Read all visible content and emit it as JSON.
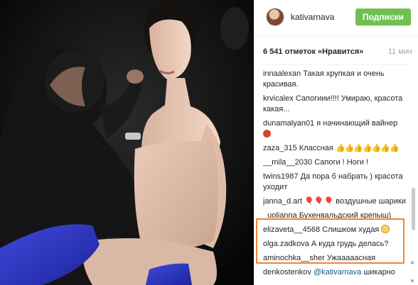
{
  "post": {
    "username": "kativarnava",
    "follow_label": "Подписки",
    "likes_text": "6 541 отметок «Нравится»",
    "timestamp": "11 мин"
  },
  "comments": [
    {
      "author": "innaalexan",
      "text": "Такая хрупкая и очень красивая."
    },
    {
      "author": "krvicalex",
      "text": "Сапогиии!!!! Умираю, красота какая..."
    },
    {
      "author": "dunamalyan01",
      "text": "я начинающий вайнер"
    },
    {
      "author": "zaza_315",
      "text": "Классная"
    },
    {
      "author": "__mila__2030",
      "text": "Сапоги ! Ноги !"
    },
    {
      "author": "twins1987",
      "text": "Да пора б набрать ) красота уходит"
    },
    {
      "author": "janna_d.art",
      "text": "воздушные шарики"
    },
    {
      "author": "_uolianna",
      "text": "Бухенвальдский крепыш)"
    },
    {
      "author": "elizaveta__4568",
      "text": "Слишком худая"
    },
    {
      "author": "olga.zadkova",
      "text": "А куда грудь делась?"
    },
    {
      "author": "aminochka__sher",
      "text": "Ужааааасная"
    },
    {
      "author": "denkostenkov",
      "mention": "@kativarnava",
      "text": "шикарно"
    }
  ],
  "colors": {
    "follow_green": "#70c050",
    "highlight_orange": "#ef8436",
    "mention_blue": "#125688"
  },
  "icons": {
    "zaza_emojis": "thumbs-up-icon",
    "janna_emojis": "balloon-icon",
    "elizaveta_emoji": "sad-face-icon",
    "dunamalyan_emoji": "face-icon"
  }
}
